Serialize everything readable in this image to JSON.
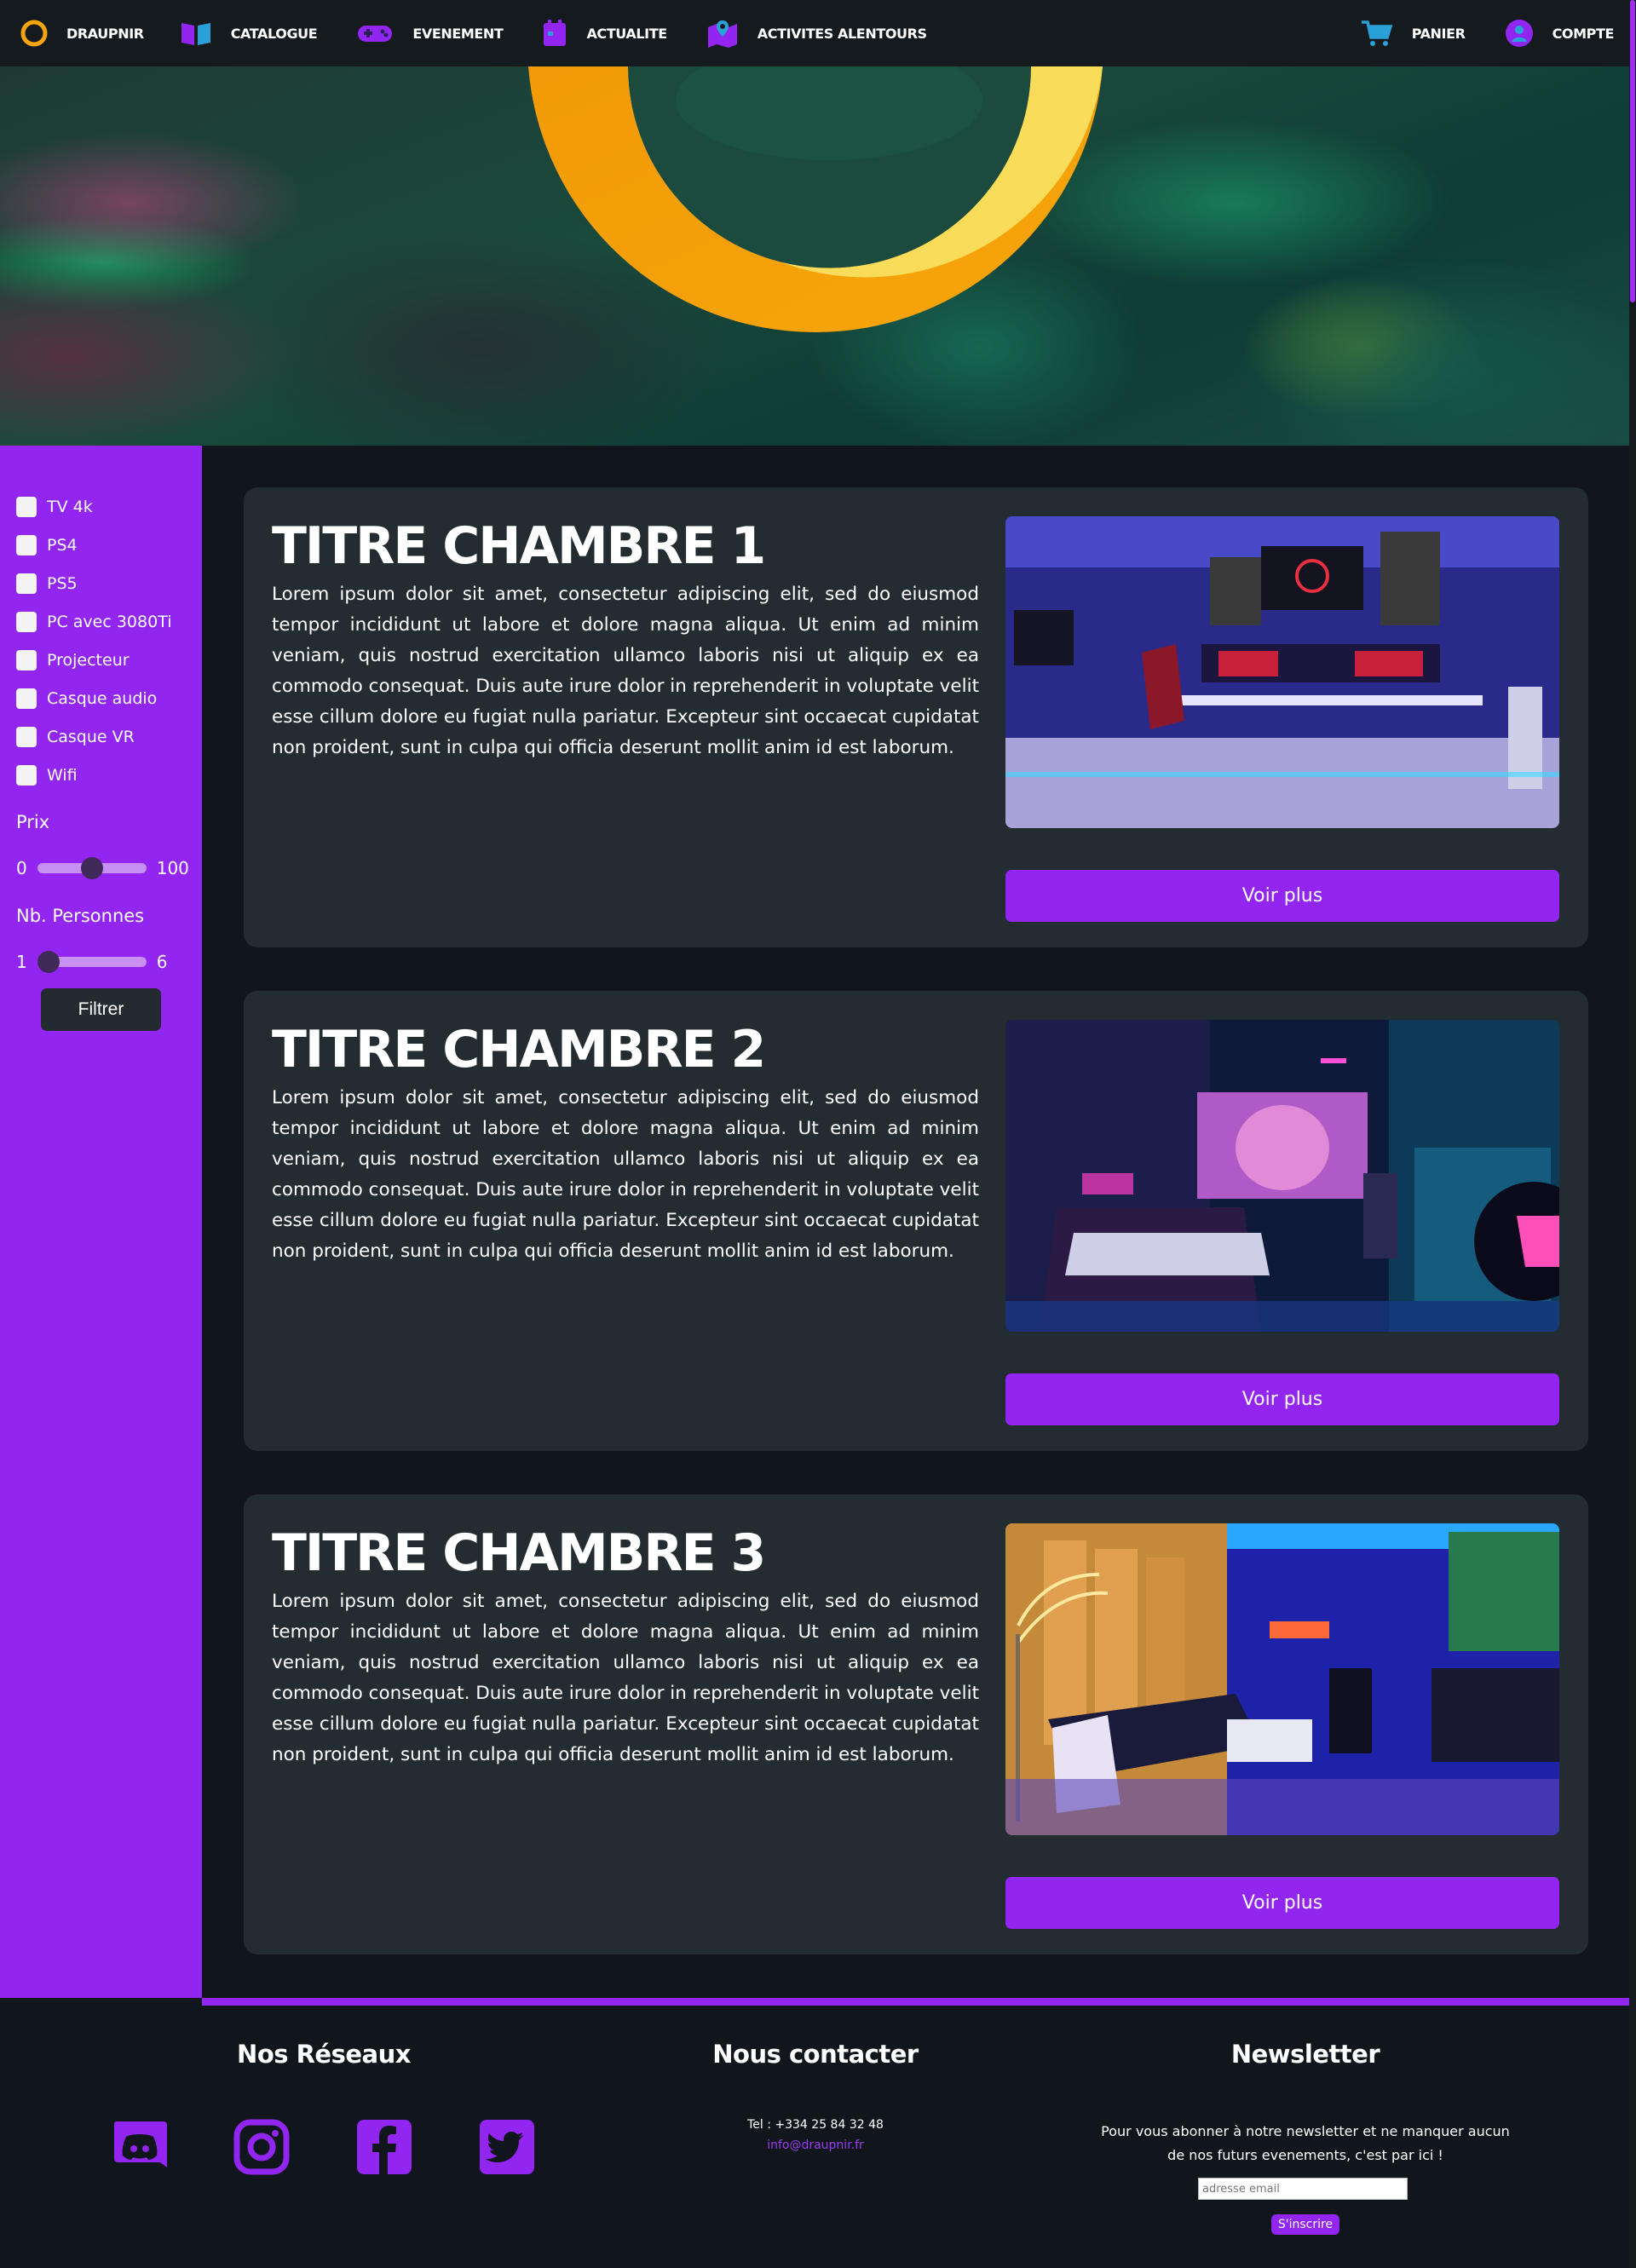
{
  "brand": {
    "name": "DRAUPNIR",
    "accent": "#9226f0",
    "ring_color": "#f7a50b"
  },
  "nav": {
    "catalogue": "CATALOGUE",
    "evenement": "EVENEMENT",
    "actualite": "ACTUALITE",
    "alentours": "ACTIVITES ALENTOURS",
    "panier": "PANIER",
    "compte": "COMPTE"
  },
  "filters": {
    "options": [
      "TV 4k",
      "PS4",
      "PS5",
      "PC avec 3080Ti",
      "Projecteur",
      "Casque audio",
      "Casque VR",
      "Wifi"
    ],
    "price": {
      "label": "Prix",
      "min": "0",
      "max": "100",
      "value": 50
    },
    "persons": {
      "label": "Nb. Personnes",
      "min": "1",
      "max": "6",
      "value": 1
    },
    "button": "Filtrer"
  },
  "rooms": [
    {
      "title": "TITRE CHAMBRE 1",
      "description": "Lorem ipsum dolor sit amet, consectetur adipiscing elit, sed do eiusmod tempor incididunt ut labore et dolore magna aliqua. Ut enim ad minim veniam, quis nostrud exercitation ullamco laboris nisi ut aliquip ex ea commodo consequat. Duis aute irure dolor in reprehenderit in voluptate velit esse cillum dolore eu fugiat nulla pariatur. Excepteur sint occaecat cupidatat non proident, sunt in culpa qui officia deserunt mollit anim id est laborum.",
      "button": "Voir plus"
    },
    {
      "title": "TITRE CHAMBRE 2",
      "description": "Lorem ipsum dolor sit amet, consectetur adipiscing elit, sed do eiusmod tempor incididunt ut labore et dolore magna aliqua. Ut enim ad minim veniam, quis nostrud exercitation ullamco laboris nisi ut aliquip ex ea commodo consequat. Duis aute irure dolor in reprehenderit in voluptate velit esse cillum dolore eu fugiat nulla pariatur. Excepteur sint occaecat cupidatat non proident, sunt in culpa qui officia deserunt mollit anim id est laborum.",
      "button": "Voir plus"
    },
    {
      "title": "TITRE CHAMBRE 3",
      "description": "Lorem ipsum dolor sit amet, consectetur adipiscing elit, sed do eiusmod tempor incididunt ut labore et dolore magna aliqua. Ut enim ad minim veniam, quis nostrud exercitation ullamco laboris nisi ut aliquip ex ea commodo consequat. Duis aute irure dolor in reprehenderit in voluptate velit esse cillum dolore eu fugiat nulla pariatur. Excepteur sint occaecat cupidatat non proident, sunt in culpa qui officia deserunt mollit anim id est laborum.",
      "button": "Voir plus"
    }
  ],
  "footer": {
    "networks_title": "Nos Réseaux",
    "contact_title": "Nous contacter",
    "newsletter_title": "Newsletter",
    "phone": "Tel : +334 25 84 32 48",
    "email": "info@draupnir.fr",
    "newsletter_line1": "Pour vous abonner à notre newsletter et ne manquer aucun",
    "newsletter_line2": "de nos futurs evenements, c'est par ici !",
    "email_placeholder": "adresse email",
    "subscribe": "S'inscrire",
    "social_icons": [
      "discord-icon",
      "instagram-icon",
      "facebook-icon",
      "twitter-icon"
    ]
  }
}
